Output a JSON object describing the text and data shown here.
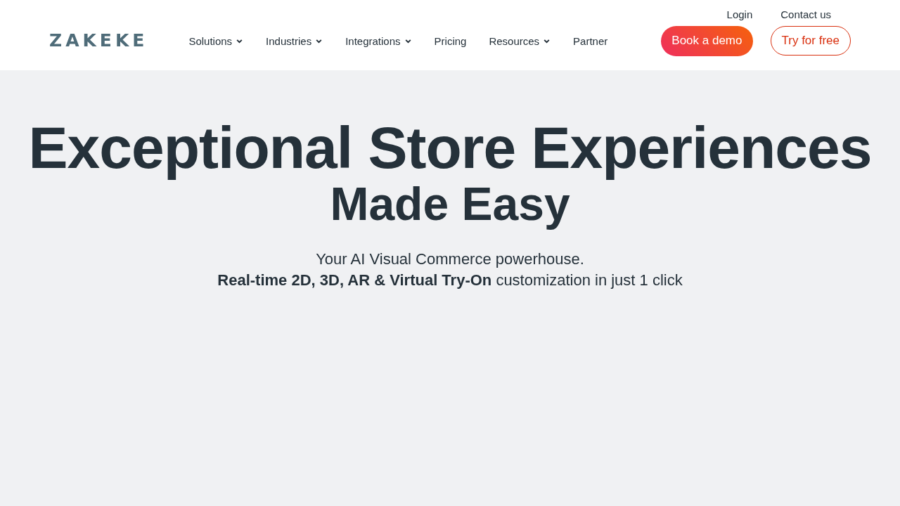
{
  "top_links": [
    "Login",
    "Contact us"
  ],
  "logo": {
    "text": "ZAKEKE"
  },
  "nav": [
    {
      "label": "Solutions",
      "has_menu": true
    },
    {
      "label": "Industries",
      "has_menu": true
    },
    {
      "label": "Integrations",
      "has_menu": true
    },
    {
      "label": "Pricing",
      "has_menu": false
    },
    {
      "label": "Resources",
      "has_menu": true
    },
    {
      "label": "Partner",
      "has_menu": false
    }
  ],
  "buttons": [
    {
      "label": "Book a demo",
      "kind": "primary"
    },
    {
      "label": "Try for free",
      "kind": "outline"
    }
  ],
  "hero": {
    "title": "Exceptional Store Experiences",
    "title_line_2": "Made Easy",
    "subtitle": "Your AI Visual Commerce powerhouse.",
    "subtitle_line_2": "**Real-time 2D, 3D, AR & Virtual Try-On** customization in just 1 click"
  }
}
